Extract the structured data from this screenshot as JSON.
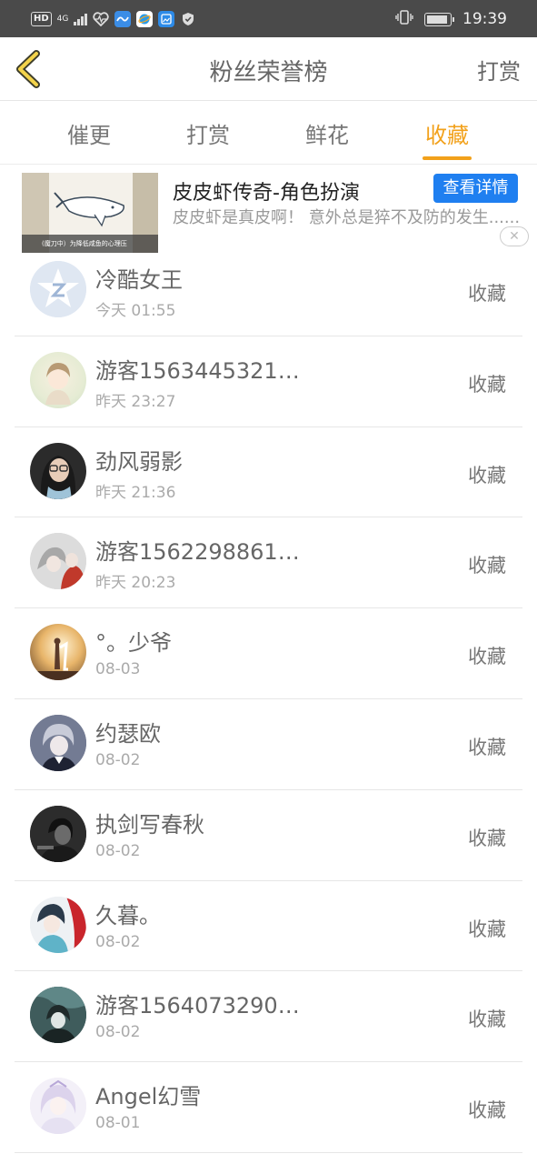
{
  "status_bar": {
    "hd": "HD",
    "network": "4G",
    "time": "19:39",
    "icons": [
      "health-heart-icon",
      "app-blue-wave-icon",
      "app-browser-icon",
      "app-gallery-icon",
      "shield-icon",
      "vibrate-icon",
      "battery-icon"
    ]
  },
  "header": {
    "title": "粉丝荣誉榜",
    "action": "打赏",
    "back_icon": "chevron-left-icon",
    "accent": "#f2a11b"
  },
  "tabs": [
    {
      "label": "催更",
      "active": false
    },
    {
      "label": "打赏",
      "active": false
    },
    {
      "label": "鲜花",
      "active": false
    },
    {
      "label": "收藏",
      "active": true
    }
  ],
  "ad": {
    "title": "皮皮虾传奇-角色扮演",
    "button": "查看详情",
    "description": "皮皮虾是真皮啊！ 意外总是猝不及防的发生......",
    "thumb_caption": "(魔刀中）为降低咸鱼的心理压",
    "close_icon": "close-icon",
    "button_color": "#1f7ff0"
  },
  "list": [
    {
      "name": "冷酷女王",
      "time": "今天 01:55",
      "action": "收藏",
      "avatar": "qq-default-avatar"
    },
    {
      "name": "游客1563445321…",
      "time": "昨天 23:27",
      "action": "收藏",
      "avatar": "anime-girl-avatar"
    },
    {
      "name": "劲风弱影",
      "time": "昨天 21:36",
      "action": "收藏",
      "avatar": "person-glasses-avatar"
    },
    {
      "name": "游客1562298861…",
      "time": "昨天 20:23",
      "action": "收藏",
      "avatar": "anime-couple-avatar"
    },
    {
      "name": "°。少爷",
      "time": "08-03",
      "action": "收藏",
      "avatar": "couple-sunset-avatar"
    },
    {
      "name": "约瑟欧",
      "time": "08-02",
      "action": "收藏",
      "avatar": "anime-boy-avatar"
    },
    {
      "name": "执剑写春秋",
      "time": "08-02",
      "action": "收藏",
      "avatar": "dark-portrait-avatar"
    },
    {
      "name": "久暮。",
      "time": "08-02",
      "action": "收藏",
      "avatar": "anime-red-avatar"
    },
    {
      "name": "游客1564073290…",
      "time": "08-02",
      "action": "收藏",
      "avatar": "anime-teal-avatar"
    },
    {
      "name": "Angel幻雪",
      "time": "08-01",
      "action": "收藏",
      "avatar": "anime-white-avatar"
    }
  ]
}
